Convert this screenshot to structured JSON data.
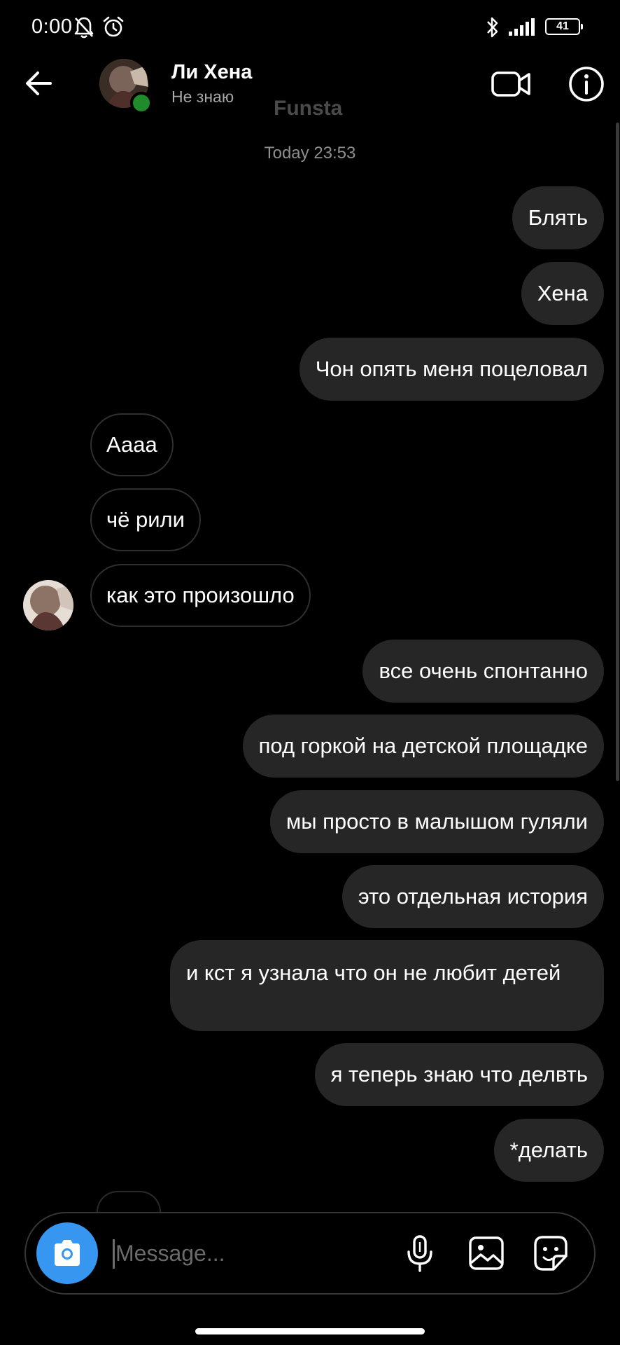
{
  "status_bar": {
    "time": "0:00",
    "battery": "41",
    "icons": [
      "bell-off-icon",
      "alarm-icon",
      "bluetooth-icon",
      "signal-icon",
      "battery-icon"
    ]
  },
  "header": {
    "name": "Ли Хена",
    "status": "Не знаю",
    "watermark": "Funsta",
    "icons": [
      "back-arrow-icon",
      "video-call-icon",
      "info-icon"
    ]
  },
  "thread": {
    "timestamp": "Today 23:53",
    "messages": [
      {
        "side": "out",
        "text": "Блять"
      },
      {
        "side": "out",
        "text": "Хена"
      },
      {
        "side": "out",
        "text": "Чон опять меня поцеловал"
      },
      {
        "side": "in",
        "text": "Аааа"
      },
      {
        "side": "in",
        "text": "чё рили"
      },
      {
        "side": "in",
        "text": "как это произошло"
      },
      {
        "side": "out",
        "text": "все очень спонтанно"
      },
      {
        "side": "out",
        "text": "под горкой на детской площадке"
      },
      {
        "side": "out",
        "text": "мы просто в малышом гуляли"
      },
      {
        "side": "out",
        "text": "это отдельная история"
      },
      {
        "side": "out",
        "text": "и кст я узнала что он не любит детей"
      },
      {
        "side": "out",
        "text": "я теперь знаю что делвть"
      },
      {
        "side": "out",
        "text": "*делать"
      }
    ]
  },
  "composer": {
    "placeholder": "Message...",
    "value": "",
    "icons": [
      "camera-icon",
      "microphone-icon",
      "gallery-icon",
      "sticker-icon"
    ]
  },
  "colors": {
    "background": "#000000",
    "outgoing_bubble": "#262626",
    "incoming_border": "#2f2f2f",
    "camera_button": "#3797f0",
    "online_dot": "#1f8b2a",
    "secondary_text": "#8e8e8e"
  }
}
